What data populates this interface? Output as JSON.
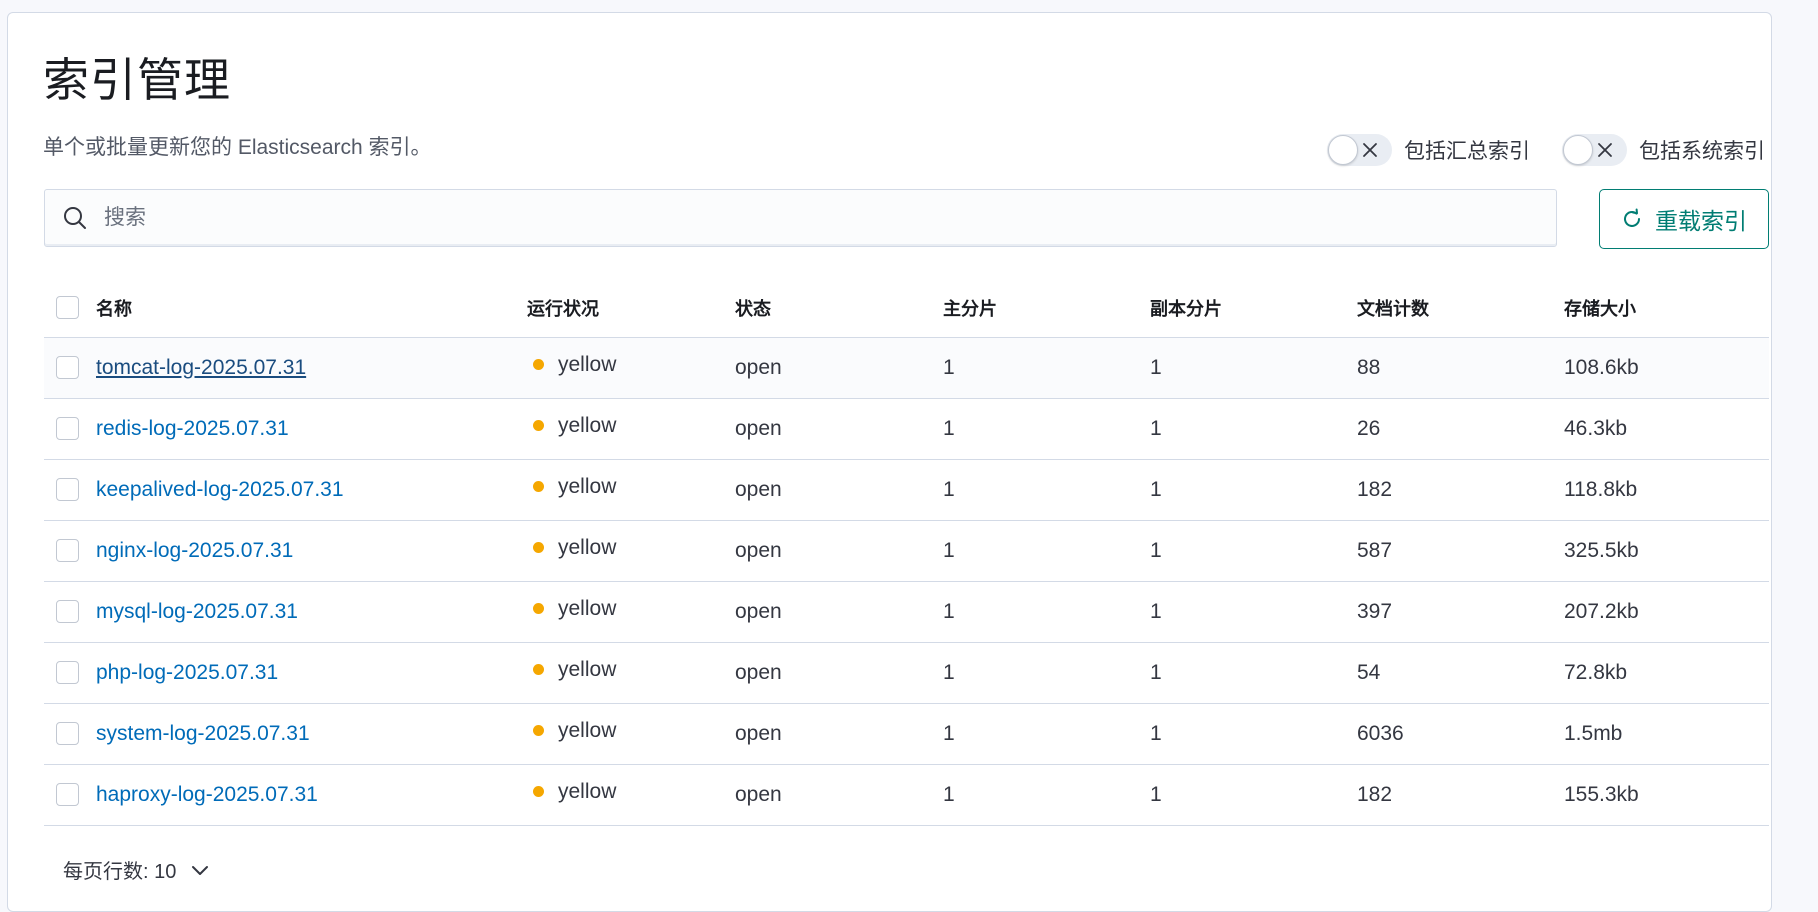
{
  "page": {
    "title": "索引管理",
    "subtitle": "单个或批量更新您的 Elasticsearch 索引。"
  },
  "toggles": [
    {
      "label": "包括汇总索引",
      "on": false
    },
    {
      "label": "包括系统索引",
      "on": false
    }
  ],
  "search": {
    "placeholder": "搜索",
    "value": ""
  },
  "reload_button": {
    "label": "重载索引",
    "icon": "refresh-icon"
  },
  "table": {
    "columns": [
      "名称",
      "运行状况",
      "状态",
      "主分片",
      "副本分片",
      "文档计数",
      "存储大小"
    ],
    "rows": [
      {
        "name": "tomcat-log-2025.07.31",
        "health": "yellow",
        "status": "open",
        "primaries": "1",
        "replicas": "1",
        "docs": "88",
        "size": "108.6kb"
      },
      {
        "name": "redis-log-2025.07.31",
        "health": "yellow",
        "status": "open",
        "primaries": "1",
        "replicas": "1",
        "docs": "26",
        "size": "46.3kb"
      },
      {
        "name": "keepalived-log-2025.07.31",
        "health": "yellow",
        "status": "open",
        "primaries": "1",
        "replicas": "1",
        "docs": "182",
        "size": "118.8kb"
      },
      {
        "name": "nginx-log-2025.07.31",
        "health": "yellow",
        "status": "open",
        "primaries": "1",
        "replicas": "1",
        "docs": "587",
        "size": "325.5kb"
      },
      {
        "name": "mysql-log-2025.07.31",
        "health": "yellow",
        "status": "open",
        "primaries": "1",
        "replicas": "1",
        "docs": "397",
        "size": "207.2kb"
      },
      {
        "name": "php-log-2025.07.31",
        "health": "yellow",
        "status": "open",
        "primaries": "1",
        "replicas": "1",
        "docs": "54",
        "size": "72.8kb"
      },
      {
        "name": "system-log-2025.07.31",
        "health": "yellow",
        "status": "open",
        "primaries": "1",
        "replicas": "1",
        "docs": "6036",
        "size": "1.5mb"
      },
      {
        "name": "haproxy-log-2025.07.31",
        "health": "yellow",
        "status": "open",
        "primaries": "1",
        "replicas": "1",
        "docs": "182",
        "size": "155.3kb"
      }
    ]
  },
  "pagination": {
    "rows_per_page_label": "每页行数: 10"
  },
  "colors": {
    "accent": "#017d73",
    "link": "#006bb8",
    "health_yellow": "#f5a700",
    "border": "#d3dae6"
  }
}
